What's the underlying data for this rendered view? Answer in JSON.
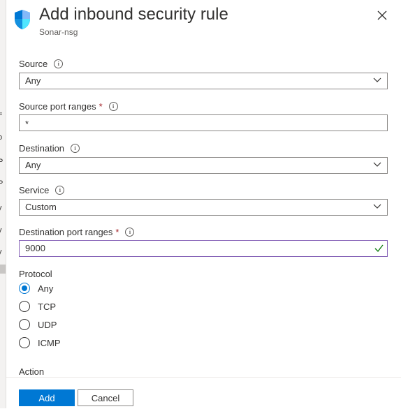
{
  "background_fragments": [
    "=",
    "o",
    "P",
    "P",
    "y",
    "y",
    "y"
  ],
  "header": {
    "title": "Add inbound security rule",
    "subtitle": "Sonar-nsg",
    "icon": "shield-icon",
    "close_icon": "close-icon"
  },
  "form": {
    "source": {
      "label": "Source",
      "value": "Any",
      "required": false
    },
    "source_port_ranges": {
      "label": "Source port ranges",
      "required_mark": "*",
      "value": "*"
    },
    "destination": {
      "label": "Destination",
      "value": "Any"
    },
    "service": {
      "label": "Service",
      "value": "Custom"
    },
    "destination_port_ranges": {
      "label": "Destination port ranges",
      "required_mark": "*",
      "value": "9000",
      "valid": true
    },
    "protocol": {
      "label": "Protocol",
      "options": [
        "Any",
        "TCP",
        "UDP",
        "ICMP"
      ],
      "selected": "Any"
    },
    "action": {
      "label": "Action"
    }
  },
  "footer": {
    "add_label": "Add",
    "cancel_label": "Cancel"
  },
  "colors": {
    "accent": "#0078d4",
    "valid_border": "#8764b8",
    "valid_check": "#107c10",
    "required": "#a4262c"
  }
}
